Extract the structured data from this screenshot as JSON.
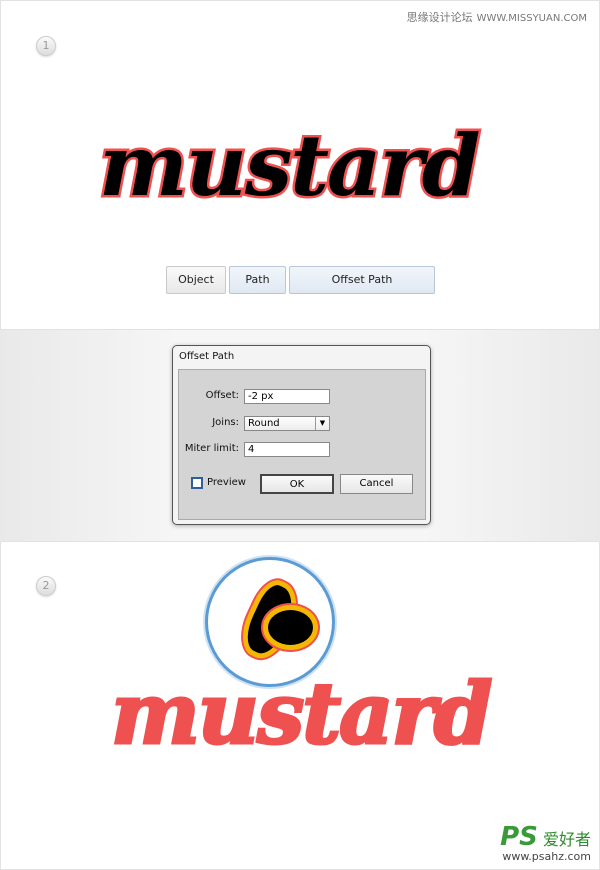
{
  "watermark": {
    "site_cn": "思缘设计论坛",
    "site_url": "WWW.MISSYUAN.COM"
  },
  "steps": [
    {
      "number": "1"
    },
    {
      "number": "2"
    }
  ],
  "artwork": {
    "word": "mustard",
    "stroke_color": "#ef5050",
    "fill_color": "#000000",
    "offset_color": "#f5b800"
  },
  "menu": {
    "items": [
      {
        "label": "Object"
      },
      {
        "label": "Path"
      },
      {
        "label": "Offset Path"
      }
    ]
  },
  "dialog": {
    "title": "Offset Path",
    "offset_label": "Offset:",
    "offset_value": "-2 px",
    "joins_label": "Joins:",
    "joins_value": "Round",
    "miter_label": "Miter limit:",
    "miter_value": "4",
    "preview_label": "Preview",
    "preview_checked": false,
    "ok_label": "OK",
    "cancel_label": "Cancel"
  },
  "footer_logo": {
    "ps": "PS",
    "cn": "爱好者",
    "url": "www.psahz.com"
  }
}
